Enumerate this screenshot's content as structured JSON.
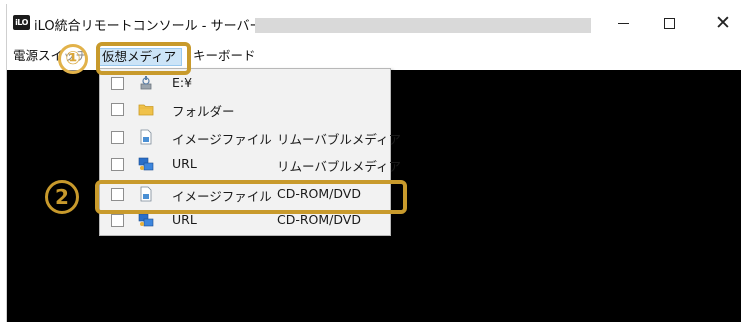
{
  "window": {
    "app_logo": "iLO",
    "title": "iLO統合リモートコンソール - サーバー:",
    "controls": {
      "minimize": "–",
      "maximize": "□",
      "close": "✕"
    }
  },
  "menubar": {
    "power": "電源スイッチ",
    "virtual_media": "仮想メディア",
    "keyboard": "キーボード"
  },
  "dropdown": {
    "items": [
      {
        "label": "E:¥",
        "sub": "",
        "icon": "drive-icon",
        "checked": false
      },
      {
        "label": "フォルダー",
        "sub": "",
        "icon": "folder-icon",
        "checked": false
      },
      {
        "label": "イメージファイル",
        "sub": "リムーバブルメディア",
        "icon": "image-file-icon",
        "checked": false
      },
      {
        "label": "URL",
        "sub": "リムーバブルメディア",
        "icon": "network-icon",
        "checked": false
      },
      {
        "label": "イメージファイル",
        "sub": "CD-ROM/DVD",
        "icon": "image-file-icon",
        "checked": false
      },
      {
        "label": "URL",
        "sub": "CD-ROM/DVD",
        "icon": "network-icon",
        "checked": false
      }
    ]
  },
  "annotations": {
    "step1": "①",
    "step2": "②",
    "color": "#c89a2c"
  },
  "colors": {
    "console": "#000000",
    "menu_highlight": "#cce4f7",
    "dropdown_bg": "#f2f2f2"
  }
}
